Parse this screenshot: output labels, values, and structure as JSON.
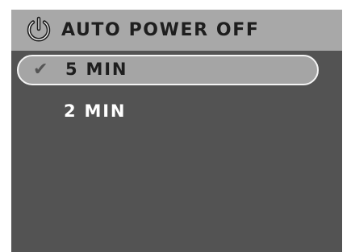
{
  "menu": {
    "title": "AUTO POWER OFF",
    "title_icon": "power-icon",
    "items": [
      {
        "label": "5 MIN",
        "selected": true,
        "check_mark": "✔"
      },
      {
        "label": "2 MIN",
        "selected": false
      }
    ]
  },
  "colors": {
    "screen_background": "#535353",
    "title_bar": "#a8a8a8",
    "selection_fill": "#a5a5a5",
    "selection_border": "#f4f4f4",
    "selected_text": "#1e1e1e",
    "unselected_text": "#ffffff"
  }
}
